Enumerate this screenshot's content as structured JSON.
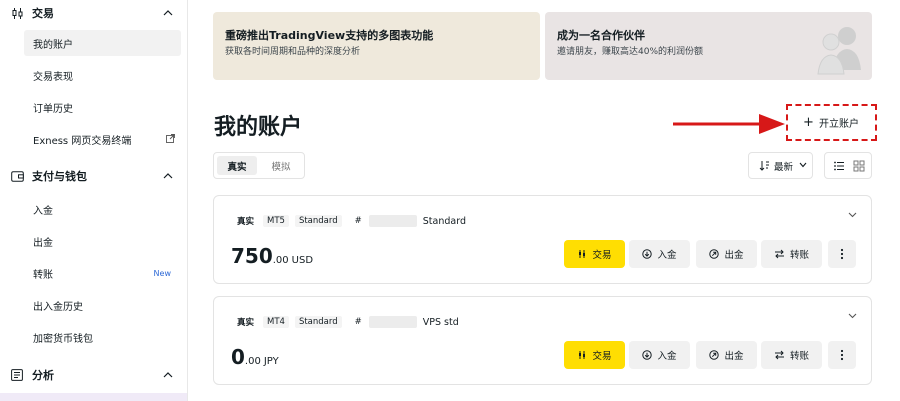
{
  "sidebar": {
    "sections": [
      {
        "label": "交易",
        "icon": "candlestick-icon"
      },
      {
        "label": "支付与钱包",
        "icon": "wallet-icon"
      },
      {
        "label": "分析",
        "icon": "analytics-icon"
      }
    ],
    "trading_items": [
      "我的账户",
      "交易表现",
      "订单历史",
      "Exness 网页交易终端"
    ],
    "payment_items": [
      "入金",
      "出金",
      "转账",
      "出入金历史",
      "加密货币钱包"
    ],
    "new_badge": "New"
  },
  "banners": [
    {
      "title": "重磅推出TradingView支持的多图表功能",
      "subtitle": "获取各时间周期和品种的深度分析",
      "icon": "megaphone-icon"
    },
    {
      "title": "成为一名合作伙伴",
      "subtitle": "邀请朋友，赚取高达40%的利润份额",
      "icon": "people-icon"
    }
  ],
  "page": {
    "title": "我的账户",
    "open_account": "开立账户"
  },
  "tabs": {
    "real": "真实",
    "demo": "模拟"
  },
  "sort": {
    "label": "最新"
  },
  "accounts": [
    {
      "type": "真实",
      "platform": "MT5",
      "kind": "Standard",
      "hash": "#",
      "name": "Standard",
      "balance_int": "750",
      "balance_dec": ".00",
      "currency": "USD"
    },
    {
      "type": "真实",
      "platform": "MT4",
      "kind": "Standard",
      "hash": "#",
      "name": "VPS std",
      "balance_int": "0",
      "balance_dec": ".00",
      "currency": "JPY"
    }
  ],
  "actions": {
    "trade": "交易",
    "deposit": "入金",
    "withdraw": "出金",
    "transfer": "转账"
  },
  "colors": {
    "accent": "#ffde02",
    "highlight": "#d71818",
    "new_badge": "#2f6ad6"
  }
}
